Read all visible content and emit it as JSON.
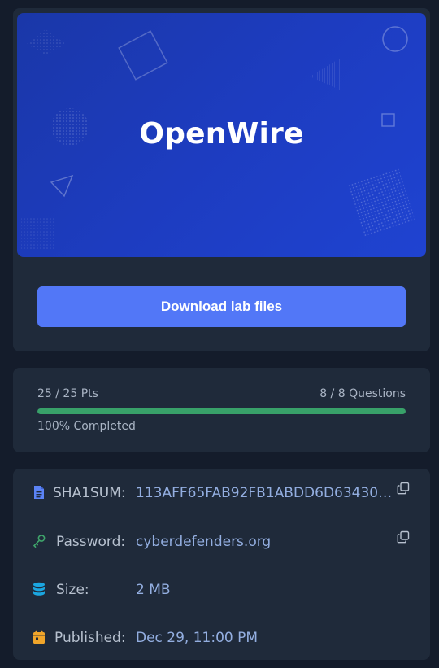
{
  "lab": {
    "title": "OpenWire",
    "download_label": "Download lab files"
  },
  "progress": {
    "points": "25 / 25 Pts",
    "questions": "8 / 8 Questions",
    "completed": "100% Completed",
    "percent": 100
  },
  "details": {
    "sha1": {
      "label": "SHA1SUM:",
      "value": "113AFF65FAB92FB1ABDD6D634300…",
      "icon": "file-icon"
    },
    "password": {
      "label": "Password:",
      "value": "cyberdefenders.org",
      "icon": "key-icon"
    },
    "size": {
      "label": "Size:",
      "value": "2 MB",
      "icon": "database-icon"
    },
    "published": {
      "label": "Published:",
      "value": "Dec 29, 11:00 PM",
      "icon": "calendar-icon"
    }
  },
  "colors": {
    "accent": "#5277f7",
    "progress": "#38a169",
    "file_icon": "#5b83f5",
    "key_icon": "#3fa56b",
    "database_icon": "#1ba6e0",
    "calendar_icon": "#f0a52a"
  }
}
